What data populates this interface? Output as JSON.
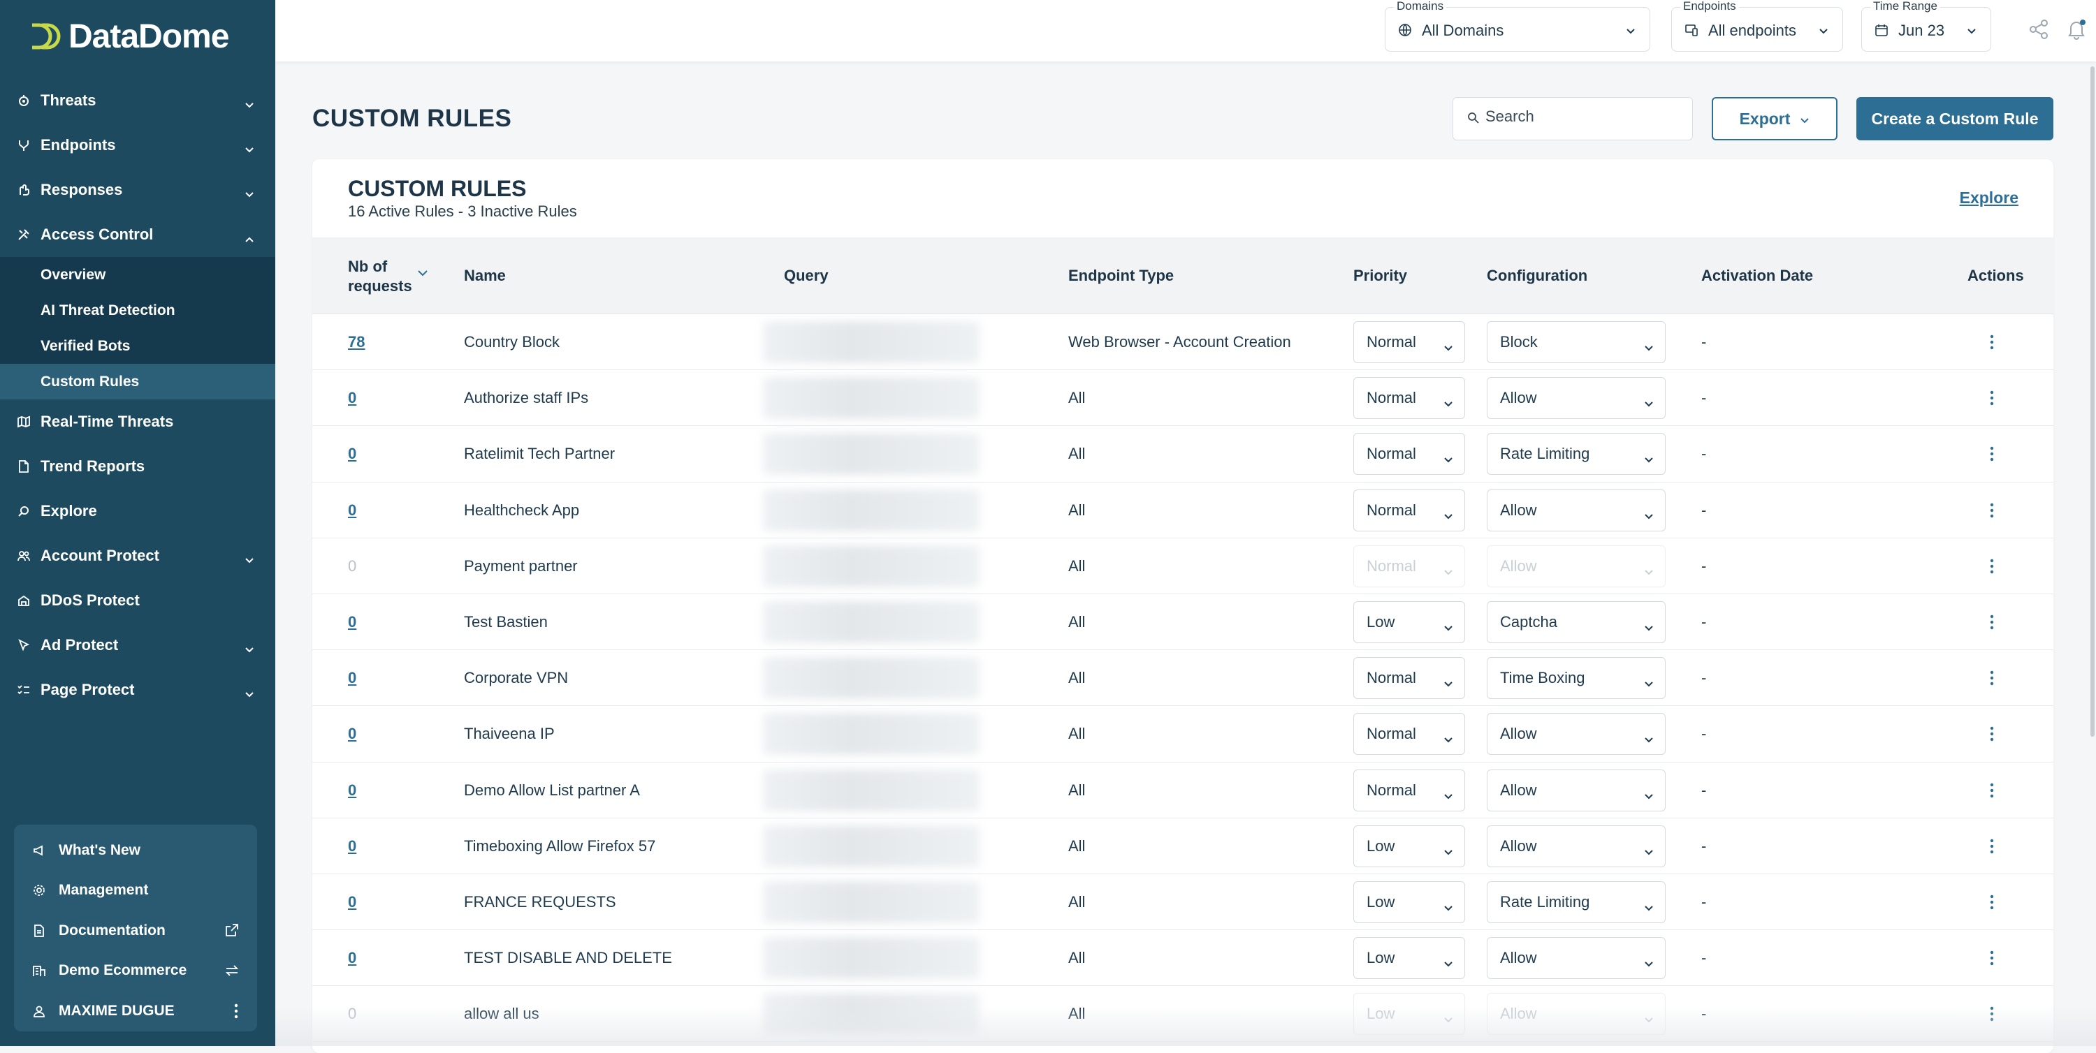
{
  "brand": {
    "name": "DataDome"
  },
  "sidebar": {
    "items": [
      {
        "label": "Threats",
        "icon": "threats-icon",
        "expandable": true
      },
      {
        "label": "Endpoints",
        "icon": "endpoints-icon",
        "expandable": true
      },
      {
        "label": "Responses",
        "icon": "responses-icon",
        "expandable": true
      },
      {
        "label": "Access Control",
        "icon": "tools-icon",
        "expandable": true,
        "expanded": true
      }
    ],
    "access_control_children": [
      {
        "label": "Overview"
      },
      {
        "label": "AI Threat Detection"
      },
      {
        "label": "Verified Bots"
      },
      {
        "label": "Custom Rules",
        "active": true
      }
    ],
    "items_after": [
      {
        "label": "Real-Time Threats",
        "icon": "map-icon",
        "expandable": false
      },
      {
        "label": "Trend Reports",
        "icon": "report-icon",
        "expandable": false
      },
      {
        "label": "Explore",
        "icon": "explore-icon",
        "expandable": false
      },
      {
        "label": "Account Protect",
        "icon": "users-icon",
        "expandable": true
      },
      {
        "label": "DDoS Protect",
        "icon": "ddos-icon",
        "expandable": false
      },
      {
        "label": "Ad Protect",
        "icon": "cursor-icon",
        "expandable": true
      },
      {
        "label": "Page Protect",
        "icon": "checklist-icon",
        "expandable": true
      }
    ],
    "bottom": [
      {
        "label": "What's New",
        "icon": "megaphone-icon"
      },
      {
        "label": "Management",
        "icon": "gear-icon"
      },
      {
        "label": "Documentation",
        "icon": "document-icon",
        "right_icon": "external-link-icon"
      },
      {
        "label": "Demo Ecommerce",
        "icon": "building-icon",
        "right_icon": "swap-icon"
      },
      {
        "label": "MAXIME DUGUE",
        "icon": "user-icon",
        "right_icon": "kebab-icon"
      }
    ]
  },
  "topbar": {
    "domains": {
      "label": "Domains",
      "value": "All Domains"
    },
    "endpoints": {
      "label": "Endpoints",
      "value": "All endpoints"
    },
    "time_range": {
      "label": "Time Range",
      "value": "Jun 23"
    }
  },
  "page": {
    "title": "CUSTOM RULES",
    "search_placeholder": "Search",
    "export_label": "Export",
    "create_label": "Create a Custom Rule"
  },
  "card": {
    "title": "CUSTOM RULES",
    "subtitle": "16 Active Rules - 3 Inactive Rules",
    "explore_label": "Explore"
  },
  "table": {
    "columns": {
      "requests": "Nb of requests",
      "name": "Name",
      "query": "Query",
      "endpoint_type": "Endpoint Type",
      "priority": "Priority",
      "configuration": "Configuration",
      "activation_date": "Activation Date",
      "actions": "Actions"
    },
    "rows": [
      {
        "count": "78",
        "name": "Country Block",
        "endpoint": "Web Browser - Account Creation",
        "priority": "Normal",
        "config": "Block",
        "date": "-",
        "active": true
      },
      {
        "count": "0",
        "name": "Authorize staff IPs",
        "endpoint": "All",
        "priority": "Normal",
        "config": "Allow",
        "date": "-",
        "active": true
      },
      {
        "count": "0",
        "name": "Ratelimit Tech Partner",
        "endpoint": "All",
        "priority": "Normal",
        "config": "Rate Limiting",
        "date": "-",
        "active": true
      },
      {
        "count": "0",
        "name": "Healthcheck App",
        "endpoint": "All",
        "priority": "Normal",
        "config": "Allow",
        "date": "-",
        "active": true
      },
      {
        "count": "0",
        "name": "Payment partner",
        "endpoint": "All",
        "priority": "Normal",
        "config": "Allow",
        "date": "-",
        "active": false
      },
      {
        "count": "0",
        "name": "Test Bastien",
        "endpoint": "All",
        "priority": "Low",
        "config": "Captcha",
        "date": "-",
        "active": true
      },
      {
        "count": "0",
        "name": "Corporate VPN",
        "endpoint": "All",
        "priority": "Normal",
        "config": "Time Boxing",
        "date": "-",
        "active": true
      },
      {
        "count": "0",
        "name": "Thaiveena IP",
        "endpoint": "All",
        "priority": "Normal",
        "config": "Allow",
        "date": "-",
        "active": true
      },
      {
        "count": "0",
        "name": "Demo Allow List partner A",
        "endpoint": "All",
        "priority": "Normal",
        "config": "Allow",
        "date": "-",
        "active": true
      },
      {
        "count": "0",
        "name": "Timeboxing Allow Firefox 57",
        "endpoint": "All",
        "priority": "Low",
        "config": "Allow",
        "date": "-",
        "active": true
      },
      {
        "count": "0",
        "name": "FRANCE REQUESTS",
        "endpoint": "All",
        "priority": "Low",
        "config": "Rate Limiting",
        "date": "-",
        "active": true
      },
      {
        "count": "0",
        "name": "TEST DISABLE AND DELETE",
        "endpoint": "All",
        "priority": "Low",
        "config": "Allow",
        "date": "-",
        "active": true
      },
      {
        "count": "0",
        "name": "allow all us",
        "endpoint": "All",
        "priority": "Low",
        "config": "Allow",
        "date": "-",
        "active": false
      }
    ]
  },
  "colors": {
    "sidebar": "#1e4a60",
    "accent": "#2c6e94",
    "logo_accent": "#c5d94a"
  }
}
